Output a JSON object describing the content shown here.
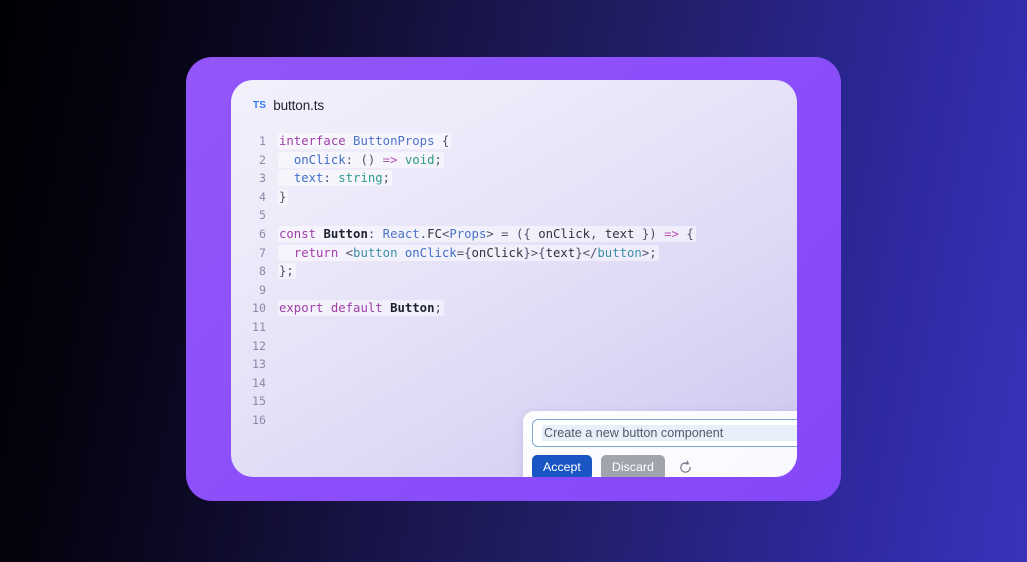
{
  "window": {
    "background_left": "#000004",
    "background_right": "#3834bb",
    "frame_color": "#8c4ffb",
    "card_gradient_start": "#f2f0fb",
    "card_gradient_end": "#cdc5ef"
  },
  "file_tab": {
    "language_badge": "TS",
    "file_name": "button.ts",
    "badge_color": "#2f7bf0"
  },
  "editor": {
    "line_numbers": [
      "1",
      "2",
      "3",
      "4",
      "5",
      "6",
      "7",
      "8",
      "9",
      "10",
      "11",
      "12",
      "13",
      "14",
      "15",
      "16"
    ],
    "lines": [
      {
        "number": "1",
        "tokens": [
          {
            "t": "interface",
            "c": "t-key"
          },
          {
            "t": " ",
            "c": "t-plain"
          },
          {
            "t": "ButtonProps",
            "c": "t-type"
          },
          {
            "t": " ",
            "c": "t-plain"
          },
          {
            "t": "{",
            "c": "t-punc"
          }
        ]
      },
      {
        "number": "2",
        "tokens": [
          {
            "t": "  ",
            "c": "t-plain"
          },
          {
            "t": "onClick",
            "c": "t-prop"
          },
          {
            "t": ": ",
            "c": "t-punc"
          },
          {
            "t": "()",
            "c": "t-punc"
          },
          {
            "t": " ",
            "c": "t-plain"
          },
          {
            "t": "=>",
            "c": "t-arrow"
          },
          {
            "t": " ",
            "c": "t-plain"
          },
          {
            "t": "void",
            "c": "t-prim"
          },
          {
            "t": ";",
            "c": "t-punc"
          }
        ]
      },
      {
        "number": "3",
        "tokens": [
          {
            "t": "  ",
            "c": "t-plain"
          },
          {
            "t": "text",
            "c": "t-prop"
          },
          {
            "t": ": ",
            "c": "t-punc"
          },
          {
            "t": "string",
            "c": "t-prim"
          },
          {
            "t": ";",
            "c": "t-punc"
          }
        ]
      },
      {
        "number": "4",
        "tokens": [
          {
            "t": "}",
            "c": "t-punc"
          }
        ]
      },
      {
        "number": "5",
        "tokens": []
      },
      {
        "number": "6",
        "tokens": [
          {
            "t": "const",
            "c": "t-key"
          },
          {
            "t": " ",
            "c": "t-plain"
          },
          {
            "t": "Button",
            "c": "t-ident"
          },
          {
            "t": ": ",
            "c": "t-punc"
          },
          {
            "t": "React",
            "c": "t-type"
          },
          {
            "t": ".",
            "c": "t-punc"
          },
          {
            "t": "FC",
            "c": "t-plain"
          },
          {
            "t": "<",
            "c": "t-punc"
          },
          {
            "t": "Props",
            "c": "t-type"
          },
          {
            "t": ">",
            "c": "t-punc"
          },
          {
            "t": " = ",
            "c": "t-punc"
          },
          {
            "t": "({ ",
            "c": "t-punc"
          },
          {
            "t": "onClick",
            "c": "t-plain"
          },
          {
            "t": ", ",
            "c": "t-punc"
          },
          {
            "t": "text",
            "c": "t-plain"
          },
          {
            "t": " })",
            "c": "t-punc"
          },
          {
            "t": " ",
            "c": "t-plain"
          },
          {
            "t": "=>",
            "c": "t-arrow"
          },
          {
            "t": " ",
            "c": "t-plain"
          },
          {
            "t": "{",
            "c": "t-punc"
          }
        ]
      },
      {
        "number": "7",
        "tokens": [
          {
            "t": "  ",
            "c": "t-plain"
          },
          {
            "t": "return",
            "c": "t-key"
          },
          {
            "t": " ",
            "c": "t-plain"
          },
          {
            "t": "<",
            "c": "t-punc"
          },
          {
            "t": "button",
            "c": "t-tag"
          },
          {
            "t": " ",
            "c": "t-plain"
          },
          {
            "t": "onClick",
            "c": "t-attr"
          },
          {
            "t": "={",
            "c": "t-punc"
          },
          {
            "t": "onClick",
            "c": "t-plain"
          },
          {
            "t": "}>{",
            "c": "t-punc"
          },
          {
            "t": "text",
            "c": "t-plain"
          },
          {
            "t": "}</",
            "c": "t-punc"
          },
          {
            "t": "button",
            "c": "t-tag"
          },
          {
            "t": ">;",
            "c": "t-punc"
          }
        ]
      },
      {
        "number": "8",
        "tokens": [
          {
            "t": "};",
            "c": "t-punc"
          }
        ]
      },
      {
        "number": "9",
        "tokens": []
      },
      {
        "number": "10",
        "tokens": [
          {
            "t": "export",
            "c": "t-key"
          },
          {
            "t": " ",
            "c": "t-plain"
          },
          {
            "t": "default",
            "c": "t-key"
          },
          {
            "t": " ",
            "c": "t-plain"
          },
          {
            "t": "Button",
            "c": "t-ident"
          },
          {
            "t": ";",
            "c": "t-punc"
          }
        ]
      },
      {
        "number": "11",
        "tokens": []
      },
      {
        "number": "12",
        "tokens": []
      },
      {
        "number": "13",
        "tokens": []
      },
      {
        "number": "14",
        "tokens": []
      },
      {
        "number": "15",
        "tokens": []
      },
      {
        "number": "16",
        "tokens": []
      }
    ],
    "code_plain": [
      "interface ButtonProps {",
      "  onClick: () => void;",
      "  text: string;",
      "}",
      "",
      "const Button: React.FC<Props> = ({ onClick, text }) => {",
      "  return <button onClick={onClick}>{text}</button>;",
      "};",
      "",
      "export default Button;"
    ]
  },
  "ai_panel": {
    "input": {
      "value": "Create a new button component",
      "placeholder": "Create a new button component"
    },
    "send_icon": "send-arrow-icon",
    "accept_label": "Accept",
    "discard_label": "Discard",
    "refresh_icon": "refresh-icon",
    "accept_color": "#1a55c4",
    "discard_color": "#a0a4ad"
  }
}
